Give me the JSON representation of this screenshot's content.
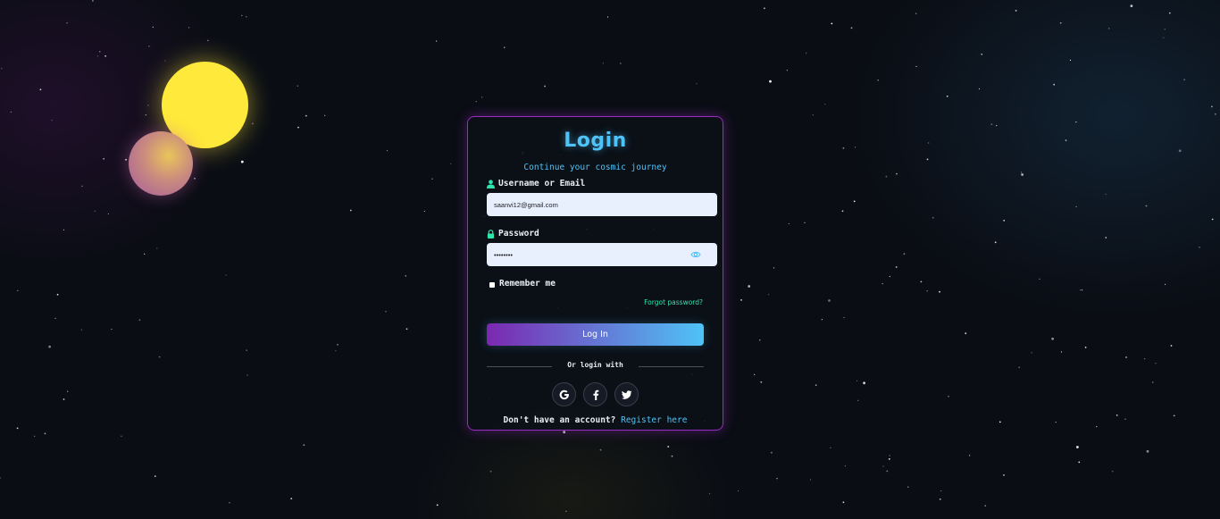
{
  "login": {
    "title": "Login",
    "subtitle": "Continue your cosmic journey",
    "username_label": "Username or Email",
    "username_value": "saanvi12@gmail.com",
    "password_label": "Password",
    "password_value": "••••••••",
    "remember_label": "Remember me",
    "forgot_link": "Forgot password?",
    "submit_label": "Log In",
    "divider_text": "Or login with",
    "social": [
      {
        "icon": "google-icon",
        "glyph": "G"
      },
      {
        "icon": "facebook-icon",
        "glyph": "f"
      },
      {
        "icon": "twitter-icon",
        "glyph": "🐦"
      }
    ],
    "register_prompt": "Don't have an account?",
    "register_link": "Register here"
  },
  "colors": {
    "accent_blue": "#4fc3f7",
    "accent_purple": "#7b28b0",
    "accent_green": "#2ee6a8",
    "card_border": "#9a2bc4",
    "background": "#0a0d14",
    "sun": "#ffe93a"
  }
}
